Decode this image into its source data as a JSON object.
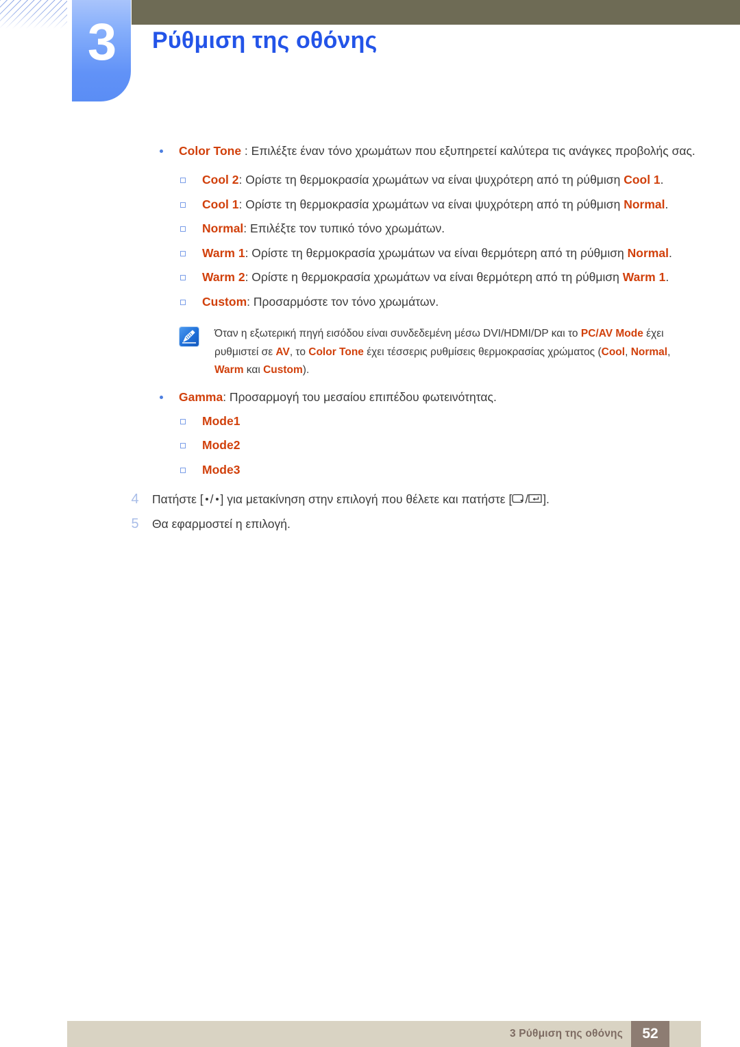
{
  "header": {
    "chapter_number": "3",
    "chapter_title": "Ρύθμιση της οθόνης",
    "title_color": "#2354e8",
    "tab_color": "#6192f7",
    "bar_color": "#6e6b55"
  },
  "content": {
    "color_tone": {
      "term": "Color Tone",
      "text": " : Επιλέξτε έναν τόνο χρωμάτων που εξυπηρετεί καλύτερα τις ανάγκες προβολής σας."
    },
    "sub_items": [
      {
        "term": "Cool 2",
        "text_before": ": Ορίστε τη θερμοκρασία χρωμάτων να είναι ψυχρότερη από τη ρύθμιση ",
        "term_end": "Cool 1",
        "text_after": "."
      },
      {
        "term": "Cool 1",
        "text_before": ": Ορίστε τη θερμοκρασία χρωμάτων να είναι ψυχρότερη από τη ρύθμιση ",
        "term_end": "Normal",
        "text_after": "."
      },
      {
        "term": "Normal",
        "text_before": ": Επιλέξτε τον τυπικό τόνο χρωμάτων.",
        "term_end": "",
        "text_after": ""
      },
      {
        "term": "Warm 1",
        "text_before": ": Ορίστε τη θερμοκρασία χρωμάτων να είναι θερμότερη από τη ρύθμιση ",
        "term_end": "Normal",
        "text_after": "."
      },
      {
        "term": "Warm 2",
        "text_before": ": Ορίστε η θερμοκρασία χρωμάτων να είναι θερμότερη από τη ρύθμιση ",
        "term_end": "Warm 1",
        "text_after": "."
      },
      {
        "term": "Custom",
        "text_before": ": Προσαρμόστε τον τόνο χρωμάτων.",
        "term_end": "",
        "text_after": ""
      }
    ],
    "note": {
      "icon": "note-pen-icon",
      "p1": "Όταν η εξωτερική πηγή εισόδου είναι συνδεδεμένη μέσω DVI/HDMI/DP και το ",
      "t1": "PC/AV Mode",
      "p2": " έχει ρυθμιστεί σε ",
      "t2": "AV",
      "p3": ", το ",
      "t3": "Color Tone",
      "p4": " έχει τέσσερις ρυθμίσεις θερμοκρασίας χρώματος (",
      "t4": "Cool",
      "p5": ", ",
      "t5": "Normal",
      "p6": ", ",
      "t6": "Warm",
      "p7": " και ",
      "t7": "Custom",
      "p8": ")."
    },
    "gamma": {
      "term": "Gamma",
      "text": ": Προσαρμογή του μεσαίου επιπέδου φωτεινότητας.",
      "modes": [
        "Mode1",
        "Mode2",
        "Mode3"
      ]
    },
    "steps": [
      {
        "number": "4",
        "part1": "Πατήστε [",
        "part2": "/",
        "part3": "] για μετακίνηση στην επιλογή που θέλετε και πατήστε [",
        "part4": "/",
        "part5": "]."
      },
      {
        "number": "5",
        "part1": "Θα εφαρμοστεί η επιλογή.",
        "part2": "",
        "part3": "",
        "part4": "",
        "part5": ""
      }
    ]
  },
  "footer": {
    "text": "3 Ρύθμιση της οθόνης",
    "page_number": "52",
    "bar_color": "#d9d3c3",
    "page_box_color": "#8d7c72",
    "text_color": "#7d6b62"
  },
  "colors": {
    "accent_term": "#d1400b",
    "body_text": "#3b3b3b",
    "step_number": "#a9bde8",
    "bullet_l1": "#4d7fe0",
    "bullet_l2": "#7a9de8"
  }
}
